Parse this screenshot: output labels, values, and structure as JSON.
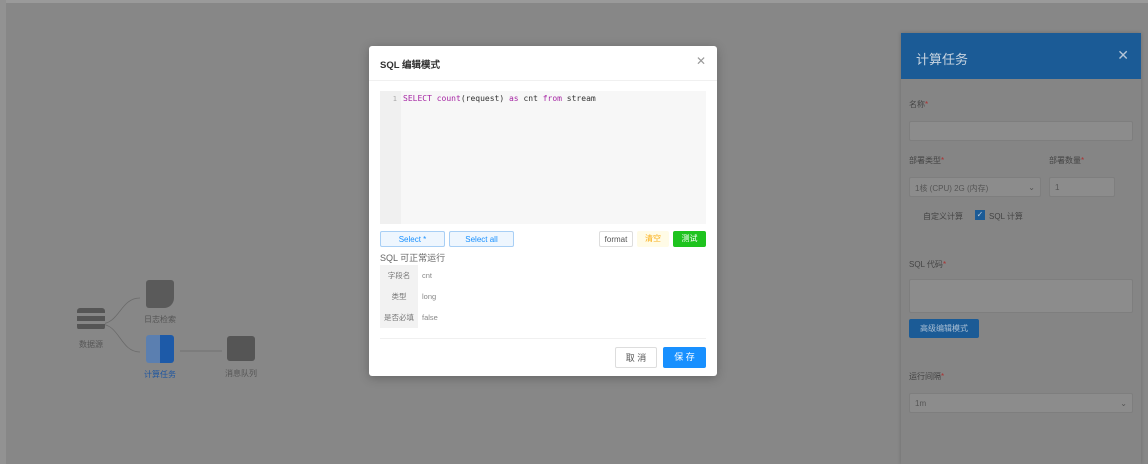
{
  "flow": {
    "nodes": [
      {
        "label": "数据源"
      },
      {
        "label": "日志检索"
      },
      {
        "label": "计算任务"
      },
      {
        "label": "消息队列"
      }
    ]
  },
  "panel": {
    "title": "计算任务",
    "name_label": "名称",
    "spec_type_label": "部署类型",
    "spec_type_value": "1核 (CPU) 2G (内存)",
    "spec_count_label": "部署数量",
    "spec_count_value": "1",
    "custom_calc_label": "自定义计算",
    "sql_calc_label": "SQL 计算",
    "sql_code_label": "SQL 代码",
    "advanced_edit_label": "高级编辑模式",
    "run_interval_label": "运行间隔",
    "run_interval_value": "1m"
  },
  "modal": {
    "title": "SQL 编辑模式",
    "line_number": "1",
    "code": {
      "t1": "SELECT",
      "t2": " count",
      "t3": "(request) ",
      "t4": "as",
      "t5": " cnt ",
      "t6": "from",
      "t7": " stream"
    },
    "select_star": "Select *",
    "select_all": "Select all",
    "format": "format",
    "clear": "清空",
    "test": "测试",
    "status": "SQL 可正常运行",
    "result_rows": [
      {
        "key": "字段名",
        "value": "cnt"
      },
      {
        "key": "类型",
        "value": "long"
      },
      {
        "key": "是否必填",
        "value": "false"
      }
    ],
    "cancel": "取 消",
    "save": "保 存"
  },
  "colors": {
    "primary": "#1890ff",
    "test_green": "#52c41a",
    "clear_orange": "#faad14"
  }
}
